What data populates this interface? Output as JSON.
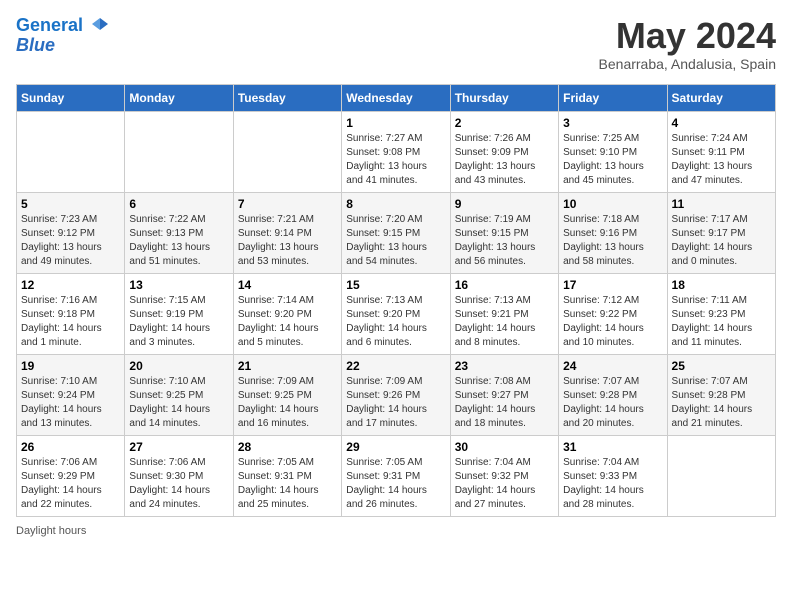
{
  "header": {
    "logo_line1": "General",
    "logo_line2": "Blue",
    "month_title": "May 2024",
    "location": "Benarraba, Andalusia, Spain"
  },
  "days_of_week": [
    "Sunday",
    "Monday",
    "Tuesday",
    "Wednesday",
    "Thursday",
    "Friday",
    "Saturday"
  ],
  "weeks": [
    [
      {
        "day": "",
        "info": ""
      },
      {
        "day": "",
        "info": ""
      },
      {
        "day": "",
        "info": ""
      },
      {
        "day": "1",
        "info": "Sunrise: 7:27 AM\nSunset: 9:08 PM\nDaylight: 13 hours\nand 41 minutes."
      },
      {
        "day": "2",
        "info": "Sunrise: 7:26 AM\nSunset: 9:09 PM\nDaylight: 13 hours\nand 43 minutes."
      },
      {
        "day": "3",
        "info": "Sunrise: 7:25 AM\nSunset: 9:10 PM\nDaylight: 13 hours\nand 45 minutes."
      },
      {
        "day": "4",
        "info": "Sunrise: 7:24 AM\nSunset: 9:11 PM\nDaylight: 13 hours\nand 47 minutes."
      }
    ],
    [
      {
        "day": "5",
        "info": "Sunrise: 7:23 AM\nSunset: 9:12 PM\nDaylight: 13 hours\nand 49 minutes."
      },
      {
        "day": "6",
        "info": "Sunrise: 7:22 AM\nSunset: 9:13 PM\nDaylight: 13 hours\nand 51 minutes."
      },
      {
        "day": "7",
        "info": "Sunrise: 7:21 AM\nSunset: 9:14 PM\nDaylight: 13 hours\nand 53 minutes."
      },
      {
        "day": "8",
        "info": "Sunrise: 7:20 AM\nSunset: 9:15 PM\nDaylight: 13 hours\nand 54 minutes."
      },
      {
        "day": "9",
        "info": "Sunrise: 7:19 AM\nSunset: 9:15 PM\nDaylight: 13 hours\nand 56 minutes."
      },
      {
        "day": "10",
        "info": "Sunrise: 7:18 AM\nSunset: 9:16 PM\nDaylight: 13 hours\nand 58 minutes."
      },
      {
        "day": "11",
        "info": "Sunrise: 7:17 AM\nSunset: 9:17 PM\nDaylight: 14 hours\nand 0 minutes."
      }
    ],
    [
      {
        "day": "12",
        "info": "Sunrise: 7:16 AM\nSunset: 9:18 PM\nDaylight: 14 hours\nand 1 minute."
      },
      {
        "day": "13",
        "info": "Sunrise: 7:15 AM\nSunset: 9:19 PM\nDaylight: 14 hours\nand 3 minutes."
      },
      {
        "day": "14",
        "info": "Sunrise: 7:14 AM\nSunset: 9:20 PM\nDaylight: 14 hours\nand 5 minutes."
      },
      {
        "day": "15",
        "info": "Sunrise: 7:13 AM\nSunset: 9:20 PM\nDaylight: 14 hours\nand 6 minutes."
      },
      {
        "day": "16",
        "info": "Sunrise: 7:13 AM\nSunset: 9:21 PM\nDaylight: 14 hours\nand 8 minutes."
      },
      {
        "day": "17",
        "info": "Sunrise: 7:12 AM\nSunset: 9:22 PM\nDaylight: 14 hours\nand 10 minutes."
      },
      {
        "day": "18",
        "info": "Sunrise: 7:11 AM\nSunset: 9:23 PM\nDaylight: 14 hours\nand 11 minutes."
      }
    ],
    [
      {
        "day": "19",
        "info": "Sunrise: 7:10 AM\nSunset: 9:24 PM\nDaylight: 14 hours\nand 13 minutes."
      },
      {
        "day": "20",
        "info": "Sunrise: 7:10 AM\nSunset: 9:25 PM\nDaylight: 14 hours\nand 14 minutes."
      },
      {
        "day": "21",
        "info": "Sunrise: 7:09 AM\nSunset: 9:25 PM\nDaylight: 14 hours\nand 16 minutes."
      },
      {
        "day": "22",
        "info": "Sunrise: 7:09 AM\nSunset: 9:26 PM\nDaylight: 14 hours\nand 17 minutes."
      },
      {
        "day": "23",
        "info": "Sunrise: 7:08 AM\nSunset: 9:27 PM\nDaylight: 14 hours\nand 18 minutes."
      },
      {
        "day": "24",
        "info": "Sunrise: 7:07 AM\nSunset: 9:28 PM\nDaylight: 14 hours\nand 20 minutes."
      },
      {
        "day": "25",
        "info": "Sunrise: 7:07 AM\nSunset: 9:28 PM\nDaylight: 14 hours\nand 21 minutes."
      }
    ],
    [
      {
        "day": "26",
        "info": "Sunrise: 7:06 AM\nSunset: 9:29 PM\nDaylight: 14 hours\nand 22 minutes."
      },
      {
        "day": "27",
        "info": "Sunrise: 7:06 AM\nSunset: 9:30 PM\nDaylight: 14 hours\nand 24 minutes."
      },
      {
        "day": "28",
        "info": "Sunrise: 7:05 AM\nSunset: 9:31 PM\nDaylight: 14 hours\nand 25 minutes."
      },
      {
        "day": "29",
        "info": "Sunrise: 7:05 AM\nSunset: 9:31 PM\nDaylight: 14 hours\nand 26 minutes."
      },
      {
        "day": "30",
        "info": "Sunrise: 7:04 AM\nSunset: 9:32 PM\nDaylight: 14 hours\nand 27 minutes."
      },
      {
        "day": "31",
        "info": "Sunrise: 7:04 AM\nSunset: 9:33 PM\nDaylight: 14 hours\nand 28 minutes."
      },
      {
        "day": "",
        "info": ""
      }
    ]
  ],
  "footer": {
    "daylight_label": "Daylight hours"
  }
}
